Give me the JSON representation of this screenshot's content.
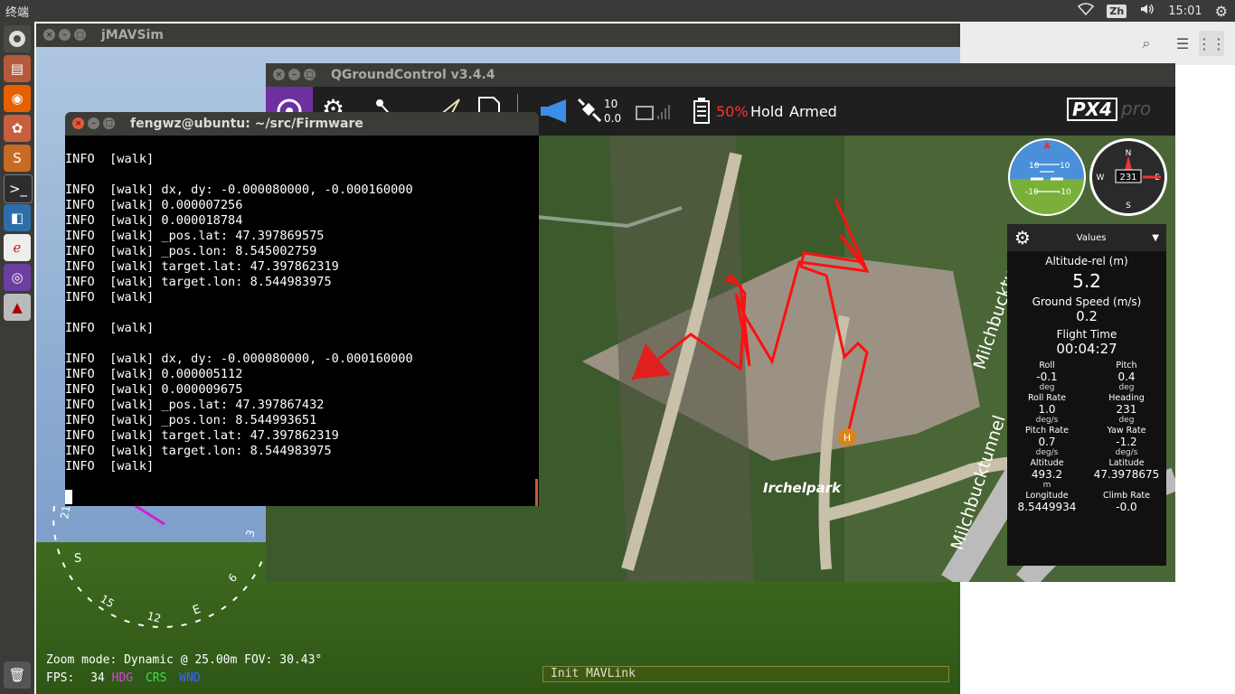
{
  "topbar": {
    "title": "终端",
    "lang": "Zh",
    "time": "15:01"
  },
  "launcher": {
    "icons": [
      "ubuntu-icon",
      "files-icon",
      "firefox-icon",
      "settings-icon",
      "store-icon",
      "terminal-icon",
      "app-icon",
      "editor-icon",
      "qgc-icon",
      "tool-icon",
      "trash-icon"
    ]
  },
  "jmavsim": {
    "title": "jMAVSim",
    "zoom_text": "Zoom mode: Dynamic @ 25.00m   FOV: 30.43°",
    "fps_label": "FPS:",
    "fps_value": "34",
    "hdg": "HDG",
    "crs": "CRS",
    "wnd": "WND",
    "status": "Init MAVLink",
    "compass_labels": [
      "21",
      "S",
      "15",
      "12",
      "E",
      "6",
      "3"
    ]
  },
  "qgc": {
    "title": "QGroundControl v3.4.4",
    "sats": "10",
    "hdop": "0.0",
    "battery": "50%",
    "mode": "Hold",
    "armed": "Armed",
    "brand": "PX4",
    "brand_sub": "autopilot",
    "brand_pro": "pro",
    "map_labels": {
      "park": "Irchelpark",
      "street1": "Milchbucktunnel",
      "street2": "Milchbucktunnel"
    },
    "home_marker": "H",
    "attitude": {
      "t1": "10",
      "t2": "10",
      "b1": "-10",
      "b2": "-10"
    },
    "heading_box": "231",
    "compass": {
      "n": "N",
      "e": "E",
      "w": "W",
      "s": "S"
    }
  },
  "values": {
    "title": "Values",
    "alt_rel_label": "Altitude-rel (m)",
    "alt_rel": "5.2",
    "gs_label": "Ground Speed (m/s)",
    "gs": "0.2",
    "ft_label": "Flight Time",
    "ft": "00:04:27",
    "grid": [
      {
        "label": "Roll",
        "value": "-0.1",
        "unit": "deg"
      },
      {
        "label": "Pitch",
        "value": "0.4",
        "unit": "deg"
      },
      {
        "label": "Roll Rate",
        "value": "1.0",
        "unit": "deg/s"
      },
      {
        "label": "Heading",
        "value": "231",
        "unit": "deg"
      },
      {
        "label": "Pitch Rate",
        "value": "0.7",
        "unit": "deg/s"
      },
      {
        "label": "Yaw Rate",
        "value": "-1.2",
        "unit": "deg/s"
      },
      {
        "label": "Altitude",
        "value": "493.2",
        "unit": "m"
      },
      {
        "label": "Latitude",
        "value": "47.3978675",
        "unit": ""
      },
      {
        "label": "Longitude",
        "value": "8.5449934",
        "unit": ""
      },
      {
        "label": "Climb Rate",
        "value": "-0.0",
        "unit": ""
      }
    ]
  },
  "terminal": {
    "title": "fengwz@ubuntu: ~/src/Firmware",
    "lines": [
      "INFO  [walk]",
      "",
      "INFO  [walk] dx, dy: -0.000080000, -0.000160000",
      "INFO  [walk] 0.000007256",
      "INFO  [walk] 0.000018784",
      "INFO  [walk] _pos.lat: 47.397869575",
      "INFO  [walk] _pos.lon: 8.545002759",
      "INFO  [walk] target.lat: 47.397862319",
      "INFO  [walk] target.lon: 8.544983975",
      "INFO  [walk]",
      "",
      "INFO  [walk]",
      "",
      "INFO  [walk] dx, dy: -0.000080000, -0.000160000",
      "INFO  [walk] 0.000005112",
      "INFO  [walk] 0.000009675",
      "INFO  [walk] _pos.lat: 47.397867432",
      "INFO  [walk] _pos.lon: 8.544993651",
      "INFO  [walk] target.lat: 47.397862319",
      "INFO  [walk] target.lon: 8.544983975",
      "INFO  [walk]"
    ]
  }
}
